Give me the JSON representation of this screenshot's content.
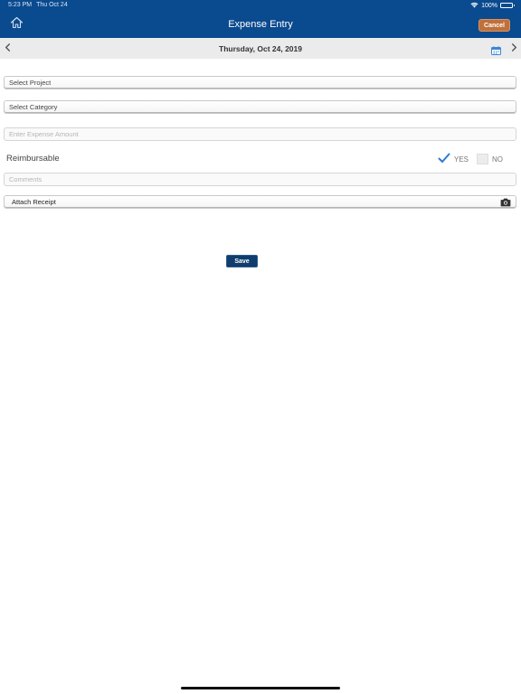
{
  "status_bar": {
    "time": "5:23 PM",
    "date": "Thu Oct 24",
    "battery": "100%"
  },
  "nav": {
    "title": "Expense Entry",
    "cancel_label": "Cancel"
  },
  "date_bar": {
    "date": "Thursday, Oct 24, 2019"
  },
  "form": {
    "project_placeholder": "Select Project",
    "category_placeholder": "Select Category",
    "amount_placeholder": "Enter Expense Amount",
    "amount_value": "",
    "reimbursable_label": "Reimbursable",
    "yes_label": "YES",
    "no_label": "NO",
    "reimbursable_selected": "YES",
    "comments_placeholder": "Comments",
    "comments_value": "",
    "attach_label": "Attach Receipt",
    "save_label": "Save"
  },
  "colors": {
    "header": "#0a4a8f",
    "cancel_button": "#c0703a",
    "save_button": "#0e3d6e",
    "check": "#2e7ad1"
  },
  "icons": {
    "home": "home-icon",
    "prev": "chevron-left-icon",
    "next": "chevron-right-icon",
    "calendar": "calendar-icon",
    "check": "checkmark-icon",
    "camera": "camera-icon"
  }
}
